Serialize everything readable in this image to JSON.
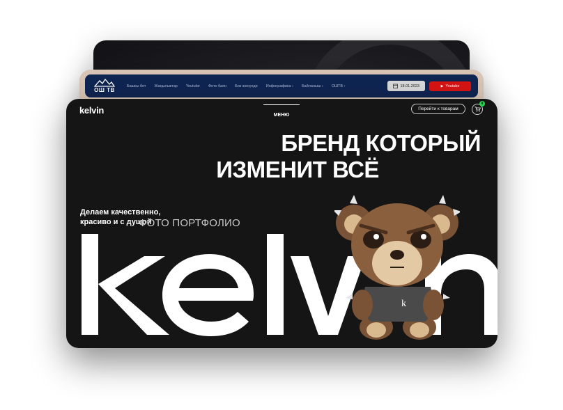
{
  "back_card": {},
  "mid_site": {
    "logo_text": "ОШ ТВ",
    "nav": [
      "Башкы бет",
      "Жаңылыктар",
      "Youtube",
      "Фото баян",
      "Биз жөнүндө",
      "Инфографика ›",
      "Байланыш ›",
      "ОШТВ ›"
    ],
    "date": "18.01.2023",
    "youtube_button": "Youtube",
    "accent_color": "#0f2552",
    "youtube_color": "#d81414"
  },
  "kelvin_site": {
    "brand": "kelvin",
    "menu_label": "МЕНЮ",
    "goods_button": "Перейти к товарам",
    "cart_count": "0",
    "headline": [
      "БРЕНД КОТОРЫЙ",
      "ИЗМЕНИТ ВСЁ"
    ],
    "tagline": [
      "Делаем качественно,",
      "красиво и с душой"
    ],
    "overlay_label": "ФОТО ПОРТФОЛИО",
    "background_color": "#151515",
    "cart_badge_color": "#27d44b"
  }
}
